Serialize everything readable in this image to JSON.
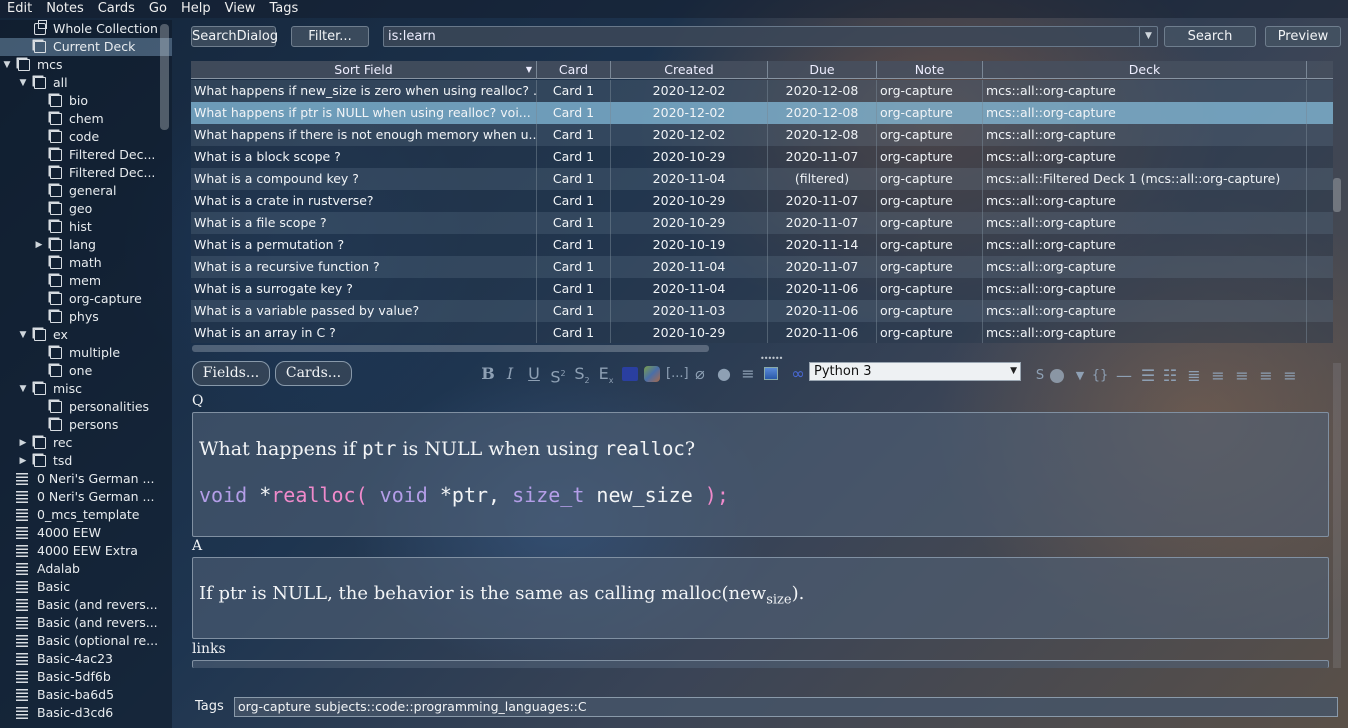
{
  "menu": [
    {
      "label": "Edit"
    },
    {
      "label": "Notes"
    },
    {
      "label": "Cards"
    },
    {
      "label": "Go"
    },
    {
      "label": "Help"
    },
    {
      "label": "View"
    },
    {
      "label": "Tags"
    }
  ],
  "sidebar": {
    "items": [
      {
        "label": "Whole Collection",
        "icon": "collection-icon",
        "arrow": ""
      },
      {
        "label": "Current Deck",
        "icon": "deck-icon",
        "arrow": ""
      },
      {
        "label": "mcs",
        "icon": "deck-icon",
        "arrow": "▼"
      },
      {
        "label": "all",
        "icon": "deck-icon",
        "arrow": "▼"
      },
      {
        "label": "bio",
        "icon": "deck-icon",
        "arrow": ""
      },
      {
        "label": "chem",
        "icon": "deck-icon",
        "arrow": ""
      },
      {
        "label": "code",
        "icon": "deck-icon",
        "arrow": ""
      },
      {
        "label": "Filtered Dec...",
        "icon": "deck-icon",
        "arrow": ""
      },
      {
        "label": "Filtered Dec...",
        "icon": "deck-icon",
        "arrow": ""
      },
      {
        "label": "general",
        "icon": "deck-icon",
        "arrow": ""
      },
      {
        "label": "geo",
        "icon": "deck-icon",
        "arrow": ""
      },
      {
        "label": "hist",
        "icon": "deck-icon",
        "arrow": ""
      },
      {
        "label": "lang",
        "icon": "deck-icon",
        "arrow": "▶"
      },
      {
        "label": "math",
        "icon": "deck-icon",
        "arrow": ""
      },
      {
        "label": "mem",
        "icon": "deck-icon",
        "arrow": ""
      },
      {
        "label": "org-capture",
        "icon": "deck-icon",
        "arrow": ""
      },
      {
        "label": "phys",
        "icon": "deck-icon",
        "arrow": ""
      },
      {
        "label": "ex",
        "icon": "deck-icon",
        "arrow": "▼"
      },
      {
        "label": "multiple",
        "icon": "deck-icon",
        "arrow": ""
      },
      {
        "label": "one",
        "icon": "deck-icon",
        "arrow": ""
      },
      {
        "label": "misc",
        "icon": "deck-icon",
        "arrow": "▼"
      },
      {
        "label": "personalities",
        "icon": "deck-icon",
        "arrow": ""
      },
      {
        "label": "persons",
        "icon": "deck-icon",
        "arrow": ""
      },
      {
        "label": "rec",
        "icon": "deck-icon",
        "arrow": "▶"
      },
      {
        "label": "tsd",
        "icon": "deck-icon",
        "arrow": "▶"
      },
      {
        "label": "0 Neri's German ...",
        "icon": "note-type-icon",
        "arrow": ""
      },
      {
        "label": "0 Neri's German ...",
        "icon": "note-type-icon",
        "arrow": ""
      },
      {
        "label": "0_mcs_template",
        "icon": "note-type-icon",
        "arrow": ""
      },
      {
        "label": "4000 EEW",
        "icon": "note-type-icon",
        "arrow": ""
      },
      {
        "label": "4000 EEW Extra",
        "icon": "note-type-icon",
        "arrow": ""
      },
      {
        "label": "Adalab",
        "icon": "note-type-icon",
        "arrow": ""
      },
      {
        "label": "Basic",
        "icon": "note-type-icon",
        "arrow": ""
      },
      {
        "label": "Basic (and revers...",
        "icon": "note-type-icon",
        "arrow": ""
      },
      {
        "label": "Basic (and revers...",
        "icon": "note-type-icon",
        "arrow": ""
      },
      {
        "label": "Basic (optional re...",
        "icon": "note-type-icon",
        "arrow": ""
      },
      {
        "label": "Basic-4ac23",
        "icon": "note-type-icon",
        "arrow": ""
      },
      {
        "label": "Basic-5df6b",
        "icon": "note-type-icon",
        "arrow": ""
      },
      {
        "label": "Basic-ba6d5",
        "icon": "note-type-icon",
        "arrow": ""
      },
      {
        "label": "Basic-d3cd6",
        "icon": "note-type-icon",
        "arrow": ""
      }
    ]
  },
  "search": {
    "searchdialog_label": "SearchDialog",
    "filter_label": "Filter...",
    "query": "is:learn",
    "search_label": "Search",
    "preview_label": "Preview"
  },
  "table": {
    "columns": [
      "Sort Field",
      "Card",
      "Created",
      "Due",
      "Note",
      "Deck"
    ],
    "rows": [
      [
        "What happens if new_size is zero when using realloc? ...",
        "Card 1",
        "2020-12-02",
        "2020-12-08",
        "org-capture",
        "mcs::all::org-capture"
      ],
      [
        "What happens if ptr is NULL when using realloc?    voi...",
        "Card 1",
        "2020-12-02",
        "2020-12-08",
        "org-capture",
        "mcs::all::org-capture"
      ],
      [
        "What happens if there is not enough memory when u...",
        "Card 1",
        "2020-12-02",
        "2020-12-08",
        "org-capture",
        "mcs::all::org-capture"
      ],
      [
        "What is a block scope ?",
        "Card 1",
        "2020-10-29",
        "2020-11-07",
        "org-capture",
        "mcs::all::org-capture"
      ],
      [
        "What is a compound key ?",
        "Card 1",
        "2020-11-04",
        "(filtered)",
        "org-capture",
        "mcs::all::Filtered Deck 1 (mcs::all::org-capture)"
      ],
      [
        "What is a crate in rustverse?",
        "Card 1",
        "2020-10-29",
        "2020-11-07",
        "org-capture",
        "mcs::all::org-capture"
      ],
      [
        "What is a file scope ?",
        "Card 1",
        "2020-10-29",
        "2020-11-07",
        "org-capture",
        "mcs::all::org-capture"
      ],
      [
        "What is a permutation ?",
        "Card 1",
        "2020-10-19",
        "2020-11-14",
        "org-capture",
        "mcs::all::org-capture"
      ],
      [
        "What is a recursive function ?",
        "Card 1",
        "2020-11-04",
        "2020-11-07",
        "org-capture",
        "mcs::all::org-capture"
      ],
      [
        "What is a surrogate key ?",
        "Card 1",
        "2020-11-04",
        "2020-11-06",
        "org-capture",
        "mcs::all::org-capture"
      ],
      [
        "What is a variable passed by value?",
        "Card 1",
        "2020-11-03",
        "2020-11-06",
        "org-capture",
        "mcs::all::org-capture"
      ],
      [
        "What is an array in C ?",
        "Card 1",
        "2020-10-29",
        "2020-11-06",
        "org-capture",
        "mcs::all::org-capture"
      ]
    ],
    "selected_row": 1
  },
  "editor": {
    "fields_label": "Fields...",
    "cards_label": "Cards...",
    "note_type": "Python 3",
    "toolbar": [
      "bold-icon",
      "italic-icon",
      "underline-icon",
      "superscript-icon",
      "subscript-icon",
      "clear-format-icon",
      "text-color-icon",
      "highlight-color-icon",
      "cloze-icon",
      "attach-icon",
      "record-icon",
      "more-icon",
      "image-icon",
      "link-icon"
    ],
    "fields": {
      "q_label": "Q",
      "q_text_1": "What happens if ",
      "q_code_ptr": "ptr",
      "q_text_2": " is NULL when using ",
      "q_code_realloc": "realloc",
      "q_text_3": "?",
      "code_kw1": "void",
      "code_star1": " *",
      "code_fn": "realloc",
      "code_paren_open": "( ",
      "code_kw2": "void",
      "code_ptr": " *ptr, ",
      "code_type": "size_t",
      "code_param": " new_size ",
      "code_paren_close": ");",
      "a_label": "A",
      "a_text": "If ptr is NULL, the behavior is the same as calling malloc(new",
      "a_sub": "size",
      "a_text_end": ").",
      "links_label": "links"
    },
    "tags_label": "Tags",
    "tags_value": "org-capture subjects::code::programming_languages::C"
  }
}
